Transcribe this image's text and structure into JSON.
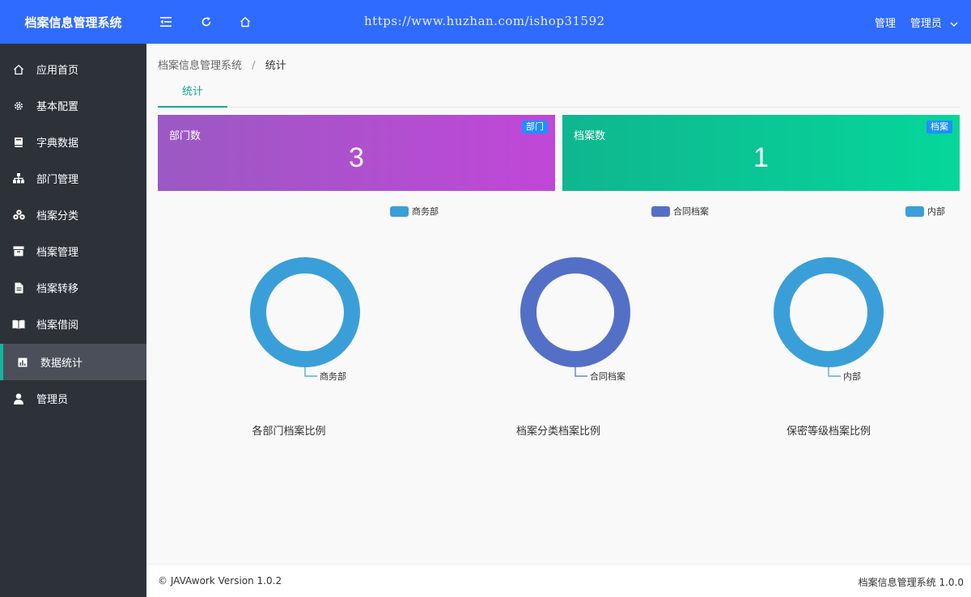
{
  "app": {
    "title": "档案信息管理系统"
  },
  "watermark": "https://www.huzhan.com/ishop31592",
  "header": {
    "icons": [
      "menu-fold-icon",
      "refresh-icon",
      "home-icon"
    ],
    "admin_link": "管理",
    "user_menu": "管理员"
  },
  "sidebar": {
    "items": [
      {
        "label": "应用首页",
        "icon": "home-icon"
      },
      {
        "label": "基本配置",
        "icon": "gear-icon"
      },
      {
        "label": "字典数据",
        "icon": "book-icon"
      },
      {
        "label": "部门管理",
        "icon": "org-chart-icon"
      },
      {
        "label": "档案分类",
        "icon": "cubes-icon"
      },
      {
        "label": "档案管理",
        "icon": "archive-box-icon"
      },
      {
        "label": "档案转移",
        "icon": "file-icon"
      },
      {
        "label": "档案借阅",
        "icon": "open-book-icon"
      },
      {
        "label": "数据统计",
        "icon": "bar-chart-icon",
        "active": true
      },
      {
        "label": "管理员",
        "icon": "user-icon"
      }
    ]
  },
  "breadcrumb": {
    "root": "档案信息管理系统",
    "sep": "/",
    "current": "统计"
  },
  "tabs": [
    {
      "label": "统计"
    }
  ],
  "cards": {
    "departments": {
      "label": "部门数",
      "value": "3",
      "badge": "部门",
      "color_from": "#9b59c3",
      "color_to": "#c147d8"
    },
    "archives": {
      "label": "档案数",
      "value": "1",
      "badge": "档案",
      "color_from": "#0fb68f",
      "color_to": "#05d79a"
    }
  },
  "chart_data": [
    {
      "type": "pie",
      "title": "各部门档案比例",
      "categories": [
        "商务部"
      ],
      "values": [
        1
      ],
      "colors": [
        "#3a9fd8"
      ],
      "legend": "top-right"
    },
    {
      "type": "pie",
      "title": "档案分类档案比例",
      "categories": [
        "合同档案"
      ],
      "values": [
        1
      ],
      "colors": [
        "#5470c6"
      ],
      "legend": "top-right"
    },
    {
      "type": "pie",
      "title": "保密等级档案比例",
      "categories": [
        "内部"
      ],
      "values": [
        1
      ],
      "colors": [
        "#3a9fd8"
      ],
      "legend": "top-right"
    }
  ],
  "footer": {
    "left": "© JAVAwork Version 1.0.2",
    "right": "档案信息管理系统 1.0.0"
  }
}
